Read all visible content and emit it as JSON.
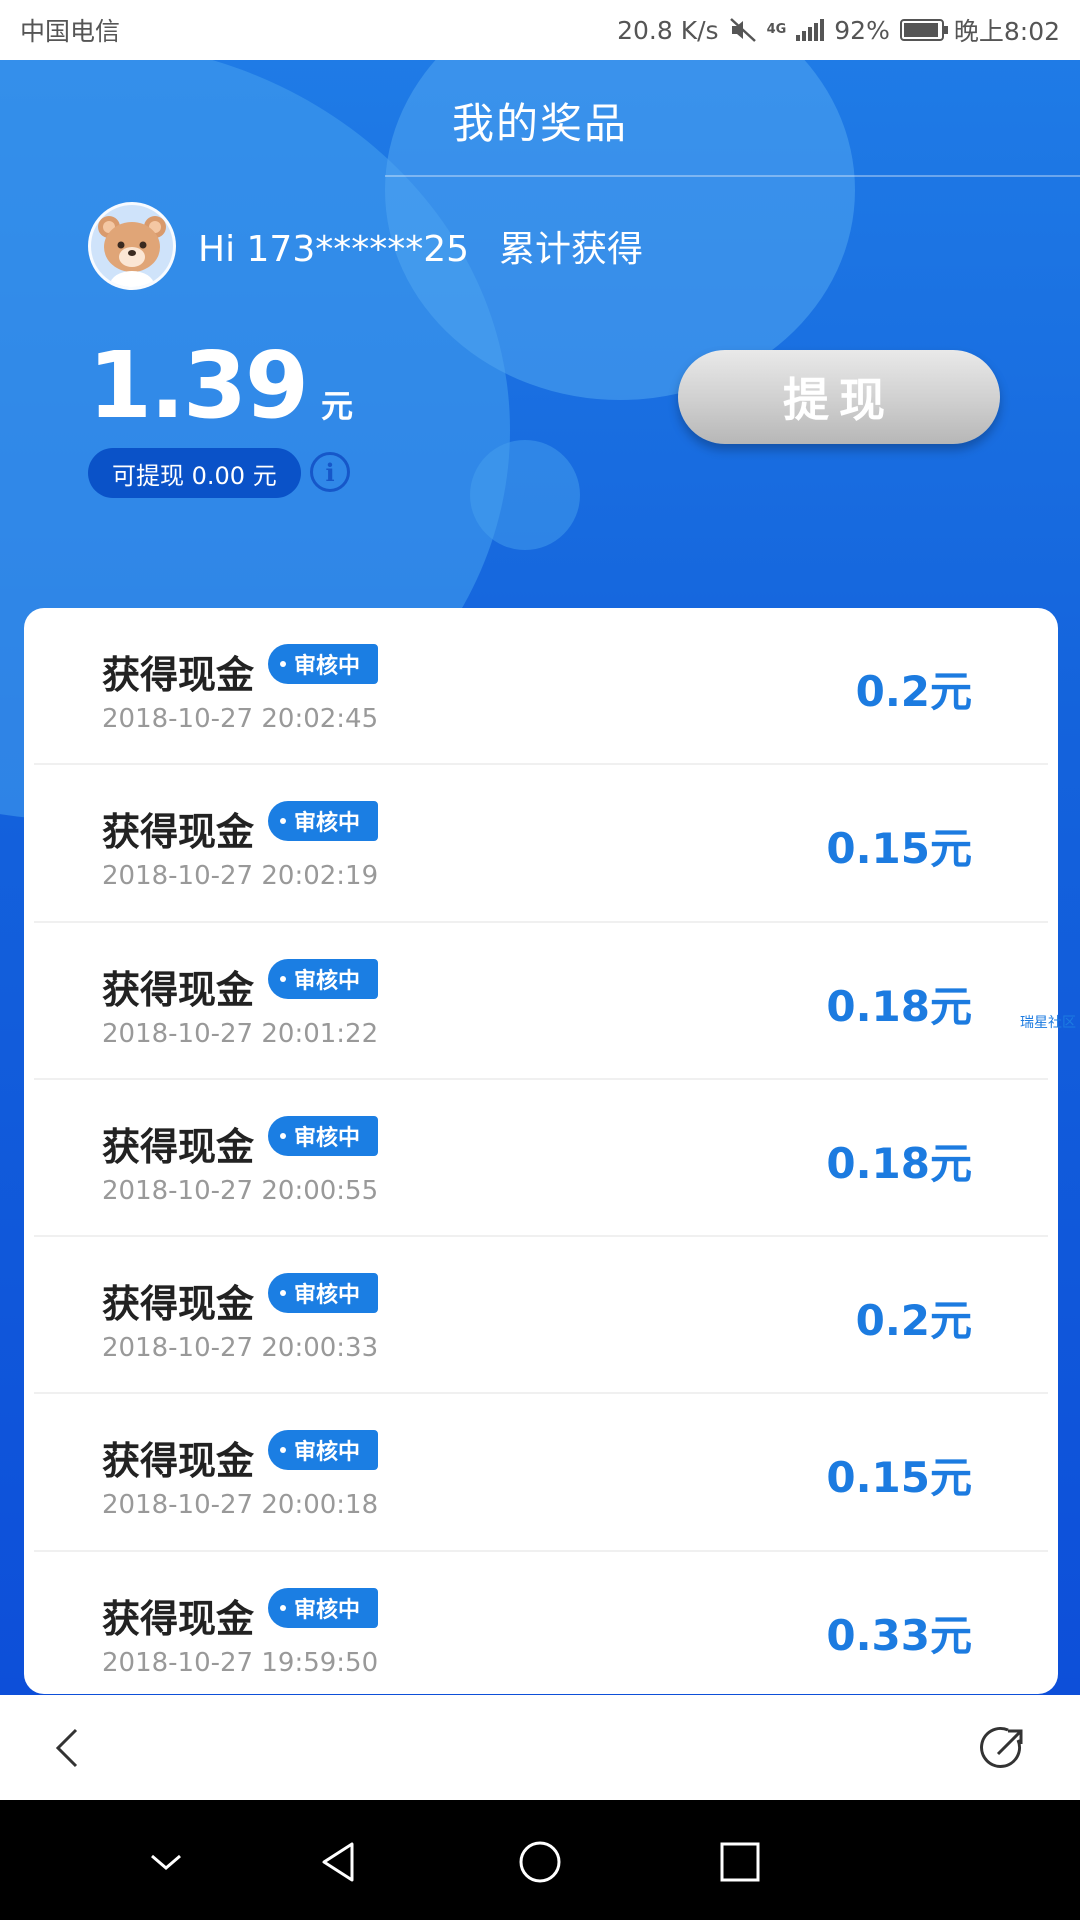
{
  "status_bar": {
    "carrier": "中国电信",
    "speed": "20.8 K/s",
    "network": "4G",
    "battery": "92%",
    "time": "晚上8:02"
  },
  "header": {
    "title": "我的奖品",
    "greeting": "Hi 173******25",
    "cumulative_label": "累计获得",
    "total_amount": "1.39",
    "total_unit": "元",
    "withdrawable": "可提现 0.00 元",
    "info_icon": "i",
    "withdraw_button": "提现"
  },
  "records": [
    {
      "title": "获得现金",
      "status": "审核中",
      "time": "2018-10-27 20:02:45",
      "amount": "0.2元"
    },
    {
      "title": "获得现金",
      "status": "审核中",
      "time": "2018-10-27 20:02:19",
      "amount": "0.15元"
    },
    {
      "title": "获得现金",
      "status": "审核中",
      "time": "2018-10-27 20:01:22",
      "amount": "0.18元"
    },
    {
      "title": "获得现金",
      "status": "审核中",
      "time": "2018-10-27 20:00:55",
      "amount": "0.18元"
    },
    {
      "title": "获得现金",
      "status": "审核中",
      "time": "2018-10-27 20:00:33",
      "amount": "0.2元"
    },
    {
      "title": "获得现金",
      "status": "审核中",
      "time": "2018-10-27 20:00:18",
      "amount": "0.15元"
    },
    {
      "title": "获得现金",
      "status": "审核中",
      "time": "2018-10-27 19:59:50",
      "amount": "0.33元"
    }
  ],
  "watermark": "瑞星社区",
  "icons": {
    "back": "back-chevron-icon",
    "share": "share-icon",
    "nav_down": "chevron-down-icon",
    "nav_back": "triangle-back-icon",
    "nav_home": "circle-home-icon",
    "nav_recent": "square-recent-icon"
  },
  "colors": {
    "primary_blue": "#1c7be0",
    "hero_blue": "#0d4fd9",
    "badge_blue": "#1b7ee3"
  }
}
